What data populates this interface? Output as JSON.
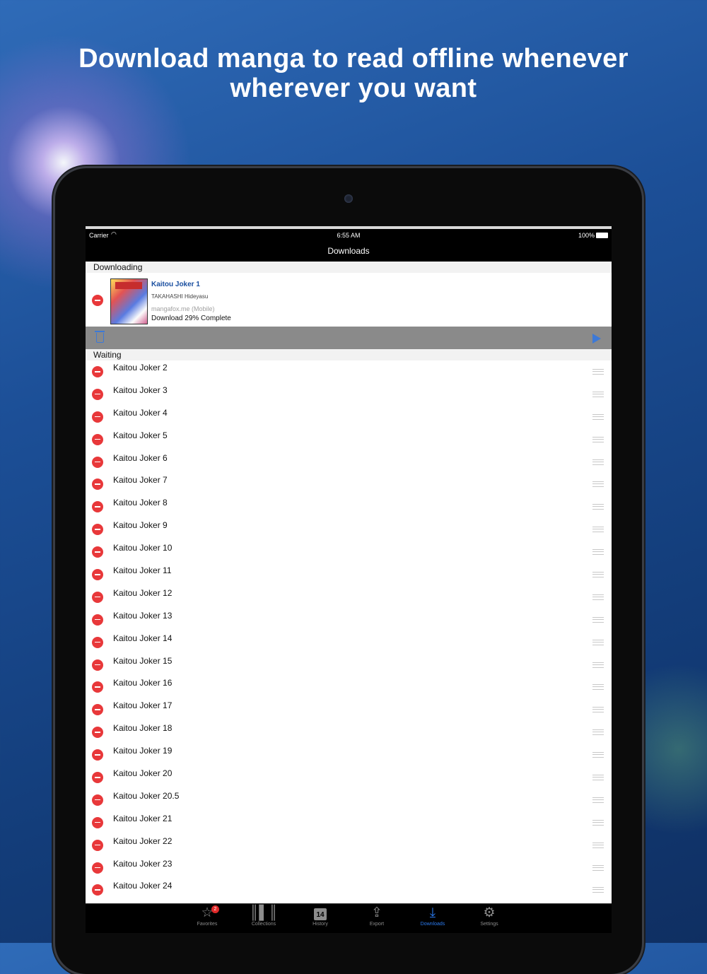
{
  "headline": {
    "line1": "Download manga to read offline whenever",
    "line2": "wherever you want"
  },
  "status_bar": {
    "carrier": "Carrier",
    "time": "6:55 AM",
    "battery": "100%"
  },
  "nav": {
    "title": "Downloads"
  },
  "downloading": {
    "header": "Downloading",
    "item": {
      "title": "Kaitou Joker 1",
      "author": "TAKAHASHI Hideyasu",
      "source": "mangafox.me (Mobile)",
      "progress_text": "Download  29% Complete",
      "progress": 0.29
    }
  },
  "waiting": {
    "header": "Waiting",
    "items": [
      "Kaitou Joker 2",
      "Kaitou Joker 3",
      "Kaitou Joker 4",
      "Kaitou Joker 5",
      "Kaitou Joker 6",
      "Kaitou Joker 7",
      "Kaitou Joker 8",
      "Kaitou Joker 9",
      "Kaitou Joker 10",
      "Kaitou Joker 11",
      "Kaitou Joker 12",
      "Kaitou Joker 13",
      "Kaitou Joker 14",
      "Kaitou Joker 15",
      "Kaitou Joker 16",
      "Kaitou Joker 17",
      "Kaitou Joker 18",
      "Kaitou Joker 19",
      "Kaitou Joker 20",
      "Kaitou Joker 20.5",
      "Kaitou Joker 21",
      "Kaitou Joker 22",
      "Kaitou Joker 23",
      "Kaitou Joker 24"
    ]
  },
  "tabs": {
    "favorites": {
      "label": "Favorites",
      "badge": "2",
      "icon": "star-icon"
    },
    "collections": {
      "label": "Collections",
      "icon": "books-icon"
    },
    "history": {
      "label": "History",
      "day": "14",
      "icon": "calendar-icon"
    },
    "export": {
      "label": "Export",
      "icon": "upload-icon"
    },
    "downloads": {
      "label": "Downloads",
      "icon": "download-icon"
    },
    "settings": {
      "label": "Settings",
      "icon": "gear-icon"
    }
  },
  "colors": {
    "accent": "#2b7bf0",
    "delete": "#e8383a",
    "title_link": "#1a4fa0"
  }
}
